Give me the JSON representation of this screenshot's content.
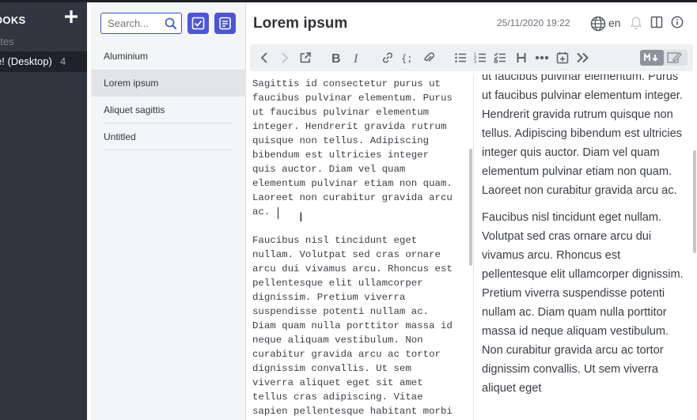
{
  "sidebar": {
    "title": "OOKS",
    "add_icon": "plus-icon",
    "all_notes": "otes",
    "notebook": {
      "label": "e! (Desktop)",
      "count": "4"
    }
  },
  "note_list": {
    "search_placeholder": "Search...",
    "items": [
      {
        "title": "Aluminium"
      },
      {
        "title": "Lorem ipsum"
      },
      {
        "title": "Aliquet sagittis"
      },
      {
        "title": "Untitled"
      }
    ],
    "selected_index": 1
  },
  "header": {
    "title": "Lorem ipsum",
    "date": "25/11/2020 19:22",
    "language": "en"
  },
  "toolbar": {
    "buttons": [
      "back-icon",
      "forward-icon",
      "external-edit-icon",
      "bold-icon",
      "italic-icon",
      "link-icon",
      "code-icon",
      "attach-icon",
      "bullet-list-icon",
      "numbered-list-icon",
      "checkbox-list-icon",
      "heading-icon",
      "horizontal-rule-icon",
      "insert-time-icon",
      "more-icon"
    ]
  },
  "editor": {
    "text": "Sagittis id consectetur purus ut\nfaucibus pulvinar elementum. Purus\nut faucibus pulvinar elementum\ninteger. Hendrerit gravida rutrum\nquisque non tellus. Adipiscing\nbibendum est ultricies integer\nquis auctor. Diam vel quam\nelementum pulvinar etiam non quam.\nLaoreet non curabitur gravida arcu\nac.\n\nFaucibus nisl tincidunt eget\nnullam. Volutpat sed cras ornare\narcu dui vivamus arcu. Rhoncus est\npellentesque elit ullamcorper\ndignissim. Pretium viverra\nsuspendisse potenti nullam ac.\nDiam quam nulla porttitor massa id\nneque aliquam vestibulum. Non\ncurabitur gravida arcu ac tortor\ndignissim convallis. Ut sem\nviverra aliquet eget sit amet\ntellus cras adipiscing. Vitae\nsapien pellentesque habitant morbi"
  },
  "preview": {
    "paragraph1": "ut faucibus pulvinar elementum. Purus ut faucibus pulvinar elementum integer. Hendrerit gravida rutrum quisque non tellus. Adipiscing bibendum est ultricies integer quis auctor. Diam vel quam elementum pulvinar etiam non quam. Laoreet non curabitur gravida arcu ac.",
    "paragraph2": "Faucibus nisl tincidunt eget nullam. Volutpat sed cras ornare arcu dui vivamus arcu. Rhoncus est pellentesque elit ullamcorper dignissim. Pretium viverra suspendisse potenti nullam ac. Diam quam nulla porttitor massa id neque aliquam vestibulum. Non curabitur gravida arcu ac tortor dignissim convallis. Ut sem viverra aliquet eget"
  },
  "colors": {
    "sidebar_bg": "#313640",
    "accent": "#4b55db",
    "list_bg": "#f4f5f6"
  }
}
